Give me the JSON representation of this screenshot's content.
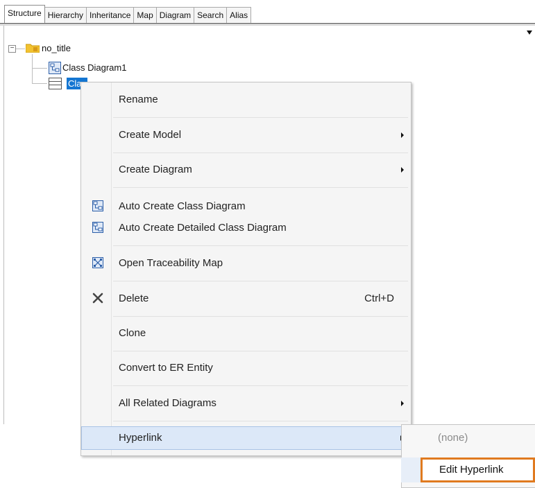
{
  "tabs": [
    "Structure",
    "Hierarchy",
    "Inheritance",
    "Map",
    "Diagram",
    "Search",
    "Alias"
  ],
  "tree": {
    "root_label": "no_title",
    "children": [
      {
        "label": "Class Diagram1",
        "icon": "class-diagram-icon"
      },
      {
        "label": "Class1",
        "icon": "class-icon",
        "selected": true
      }
    ]
  },
  "menu": {
    "rename": "Rename",
    "create_model": "Create Model",
    "create_diagram": "Create Diagram",
    "auto_create_class_diagram": "Auto Create Class Diagram",
    "auto_create_detailed_class_diagram": "Auto Create Detailed Class Diagram",
    "open_traceability_map": "Open Traceability Map",
    "delete": "Delete",
    "delete_shortcut": "Ctrl+D",
    "clone": "Clone",
    "convert_to_er_entity": "Convert to ER Entity",
    "all_related_diagrams": "All Related Diagrams",
    "hyperlink": "Hyperlink"
  },
  "submenu": {
    "none": "(none)",
    "edit_hyperlink": "Edit Hyperlink"
  },
  "colors": {
    "selection": "#1476d2",
    "highlight_border": "#e07a1f",
    "menu_hover": "#dce8f8"
  }
}
